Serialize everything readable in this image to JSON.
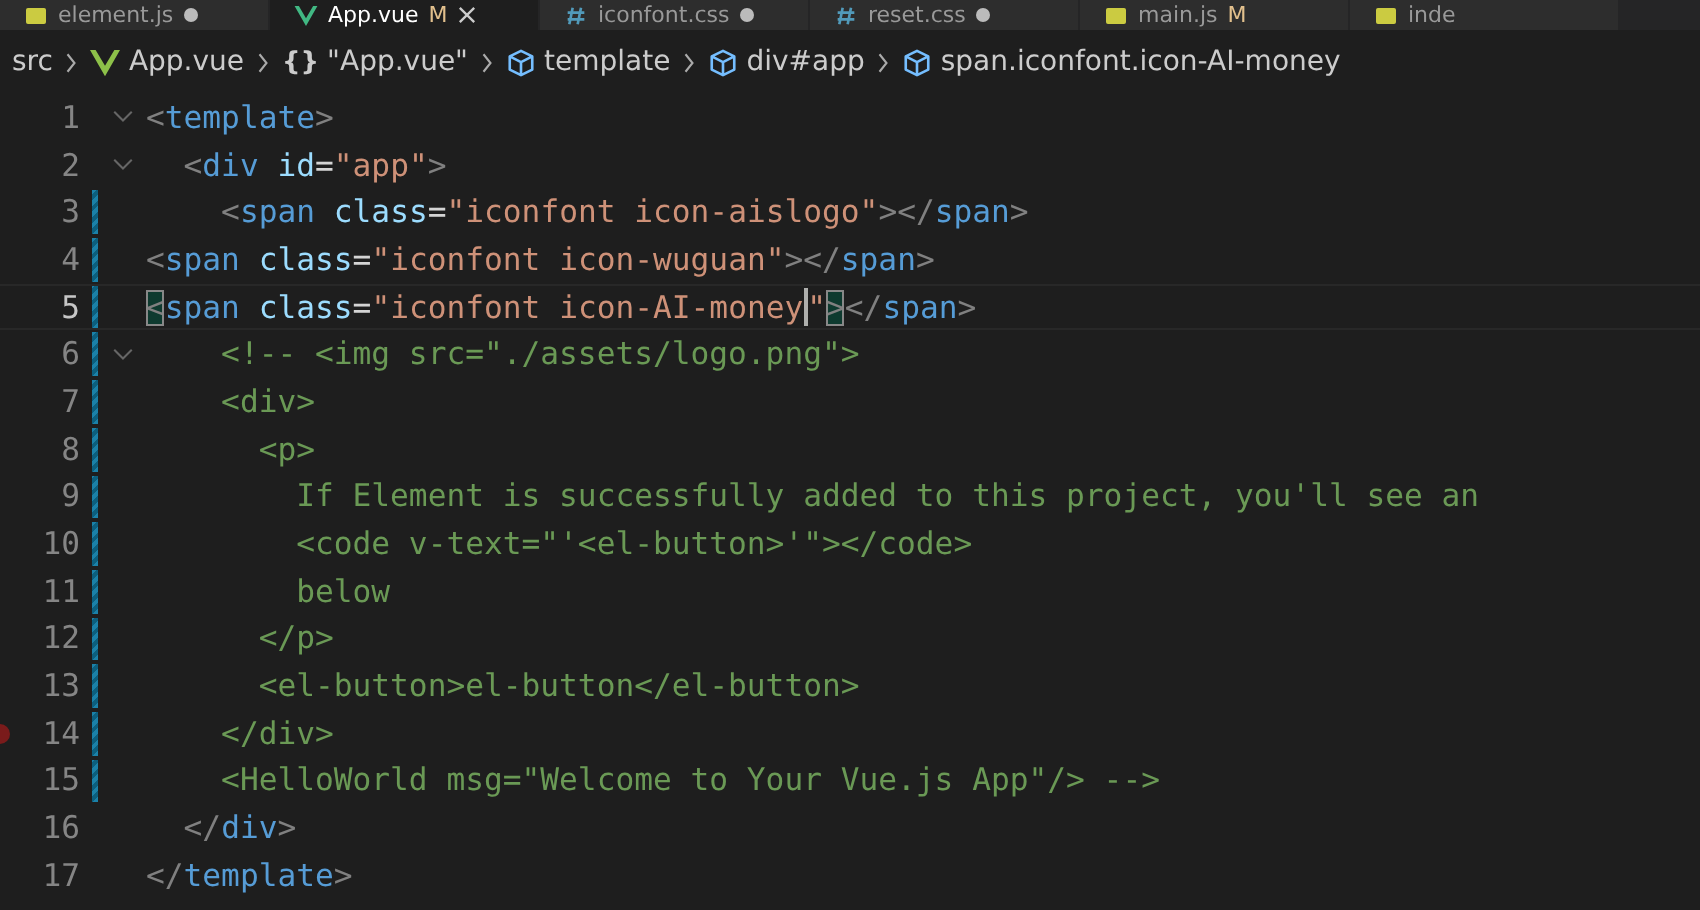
{
  "tabs": [
    {
      "label": "element.js",
      "kind": "js",
      "unsaved": true,
      "selected": false
    },
    {
      "label": "App.vue",
      "kind": "vue",
      "status": "M",
      "unsaved": false,
      "selected": true
    },
    {
      "label": "iconfont.css",
      "kind": "css",
      "unsaved": true,
      "selected": false
    },
    {
      "label": "reset.css",
      "kind": "css",
      "unsaved": true,
      "selected": false
    },
    {
      "label": "main.js",
      "kind": "js",
      "status": "M",
      "unsaved": false,
      "selected": false
    },
    {
      "label": "inde",
      "kind": "js",
      "unsaved": false,
      "selected": false
    }
  ],
  "breadcrumbs": [
    {
      "label": "src",
      "kind": "folder"
    },
    {
      "label": "App.vue",
      "kind": "vue"
    },
    {
      "label": "\"App.vue\"",
      "kind": "object",
      "symbol": "{}"
    },
    {
      "label": "template",
      "kind": "element"
    },
    {
      "label": "div#app",
      "kind": "element"
    },
    {
      "label": "span.iconfont.icon-AI-money",
      "kind": "element"
    }
  ],
  "lines": [
    {
      "number": "1",
      "foldable": true,
      "modified": false,
      "breakpoint": false,
      "current": false,
      "tokens": [
        {
          "kind": "punct",
          "text": "<"
        },
        {
          "kind": "tag",
          "text": "template"
        },
        {
          "kind": "punct",
          "text": ">"
        }
      ]
    },
    {
      "number": "2",
      "foldable": true,
      "modified": false,
      "breakpoint": false,
      "current": false,
      "tokens": [
        {
          "kind": "punct",
          "text": "  <"
        },
        {
          "kind": "tag",
          "text": "div"
        },
        {
          "kind": "attr",
          "text": " id"
        },
        {
          "kind": "eq",
          "text": "="
        },
        {
          "kind": "string",
          "text": "\"app\""
        },
        {
          "kind": "punct",
          "text": ">"
        }
      ]
    },
    {
      "number": "3",
      "foldable": false,
      "modified": true,
      "breakpoint": false,
      "current": false,
      "tokens": [
        {
          "kind": "punct",
          "text": "    <"
        },
        {
          "kind": "tag",
          "text": "span"
        },
        {
          "kind": "attr",
          "text": " class"
        },
        {
          "kind": "eq",
          "text": "="
        },
        {
          "kind": "string",
          "text": "\"iconfont icon-aislogo\""
        },
        {
          "kind": "punct",
          "text": "></"
        },
        {
          "kind": "tag",
          "text": "span"
        },
        {
          "kind": "punct",
          "text": ">"
        }
      ]
    },
    {
      "number": "4",
      "foldable": false,
      "modified": true,
      "breakpoint": false,
      "current": false,
      "tokens": [
        {
          "kind": "punct",
          "text": "<"
        },
        {
          "kind": "tag",
          "text": "span"
        },
        {
          "kind": "attr",
          "text": " class"
        },
        {
          "kind": "eq",
          "text": "="
        },
        {
          "kind": "string",
          "text": "\"iconfont icon-wuguan\""
        },
        {
          "kind": "punct",
          "text": "></"
        },
        {
          "kind": "tag",
          "text": "span"
        },
        {
          "kind": "punct",
          "text": ">"
        }
      ]
    },
    {
      "number": "5",
      "foldable": false,
      "modified": true,
      "breakpoint": false,
      "current": true,
      "tokens": [
        {
          "kind": "match",
          "text": "<"
        },
        {
          "kind": "tag",
          "text": "span"
        },
        {
          "kind": "attr",
          "text": " class"
        },
        {
          "kind": "eq",
          "text": "="
        },
        {
          "kind": "string",
          "text": "\"iconfont icon-AI-money"
        },
        {
          "kind": "caret"
        },
        {
          "kind": "string",
          "text": "\""
        },
        {
          "kind": "match",
          "text": ">"
        },
        {
          "kind": "punct",
          "text": "</"
        },
        {
          "kind": "tag",
          "text": "span"
        },
        {
          "kind": "punct",
          "text": ">"
        }
      ]
    },
    {
      "number": "6",
      "foldable": true,
      "modified": true,
      "breakpoint": false,
      "current": false,
      "tokens": [
        {
          "kind": "comment",
          "text": "    <!-- <img src=\"./assets/logo.png\">"
        }
      ]
    },
    {
      "number": "7",
      "foldable": false,
      "modified": true,
      "breakpoint": false,
      "current": false,
      "tokens": [
        {
          "kind": "comment",
          "text": "    <div>"
        }
      ]
    },
    {
      "number": "8",
      "foldable": false,
      "modified": true,
      "breakpoint": false,
      "current": false,
      "tokens": [
        {
          "kind": "comment",
          "text": "      <p>"
        }
      ]
    },
    {
      "number": "9",
      "foldable": false,
      "modified": true,
      "breakpoint": false,
      "current": false,
      "tokens": [
        {
          "kind": "comment",
          "text": "        If Element is successfully added to this project, you'll see an"
        }
      ]
    },
    {
      "number": "10",
      "foldable": false,
      "modified": true,
      "breakpoint": false,
      "current": false,
      "tokens": [
        {
          "kind": "comment",
          "text": "        <code v-text=\"'<el-button>'\"></code>"
        }
      ]
    },
    {
      "number": "11",
      "foldable": false,
      "modified": true,
      "breakpoint": false,
      "current": false,
      "tokens": [
        {
          "kind": "comment",
          "text": "        below"
        }
      ]
    },
    {
      "number": "12",
      "foldable": false,
      "modified": true,
      "breakpoint": false,
      "current": false,
      "tokens": [
        {
          "kind": "comment",
          "text": "      </p>"
        }
      ]
    },
    {
      "number": "13",
      "foldable": false,
      "modified": true,
      "breakpoint": false,
      "current": false,
      "tokens": [
        {
          "kind": "comment",
          "text": "      <el-button>el-button</el-button>"
        }
      ]
    },
    {
      "number": "14",
      "foldable": false,
      "modified": true,
      "breakpoint": true,
      "current": false,
      "tokens": [
        {
          "kind": "comment",
          "text": "    </div>"
        }
      ]
    },
    {
      "number": "15",
      "foldable": false,
      "modified": true,
      "breakpoint": false,
      "current": false,
      "tokens": [
        {
          "kind": "comment",
          "text": "    <HelloWorld msg=\"Welcome to Your Vue.js App\"/> -->"
        }
      ]
    },
    {
      "number": "16",
      "foldable": false,
      "modified": false,
      "breakpoint": false,
      "current": false,
      "tokens": [
        {
          "kind": "punct",
          "text": "  </"
        },
        {
          "kind": "tag",
          "text": "div"
        },
        {
          "kind": "punct",
          "text": ">"
        }
      ]
    },
    {
      "number": "17",
      "foldable": false,
      "modified": false,
      "breakpoint": false,
      "current": false,
      "tokens": [
        {
          "kind": "punct",
          "text": "</"
        },
        {
          "kind": "tag",
          "text": "template"
        },
        {
          "kind": "punct",
          "text": ">"
        }
      ]
    }
  ]
}
